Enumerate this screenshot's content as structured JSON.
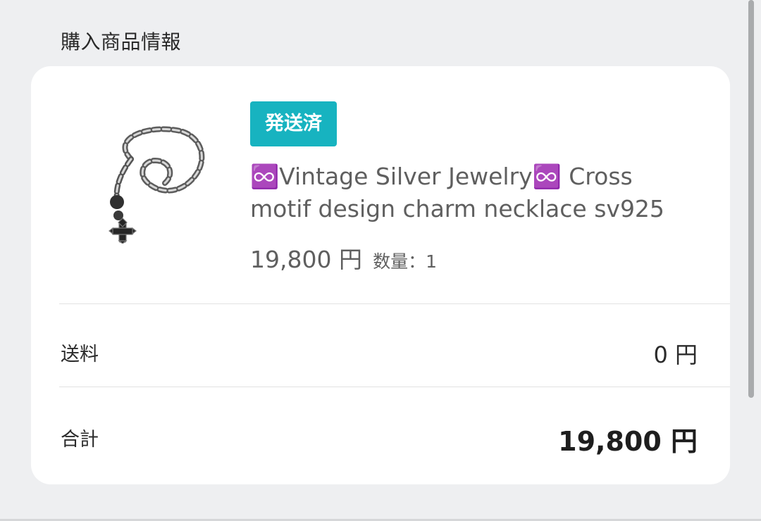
{
  "section": {
    "title": "購入商品情報"
  },
  "product": {
    "status": "発送済",
    "title": "♾️Vintage Silver Jewelry♾️ Cross motif design charm necklace sv925",
    "price": "19,800 円",
    "quantity": "数量：1"
  },
  "summary": {
    "shipping_label": "送料",
    "shipping_value": "0 円",
    "total_label": "合計",
    "total_value": "19,800 円"
  },
  "colors": {
    "background": "#eeeff1",
    "card": "#ffffff",
    "badge": "#17b3c0",
    "text_primary": "#2b2b2b",
    "text_secondary": "#5f5f5f"
  },
  "icons": {
    "product_image": "silver-cross-necklace"
  }
}
